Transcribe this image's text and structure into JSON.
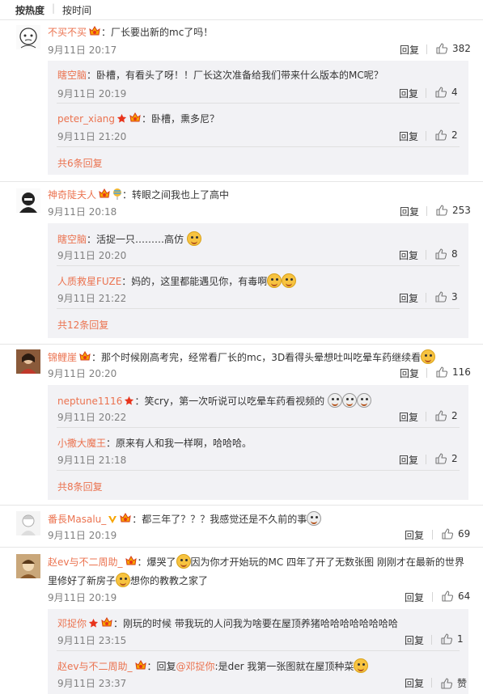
{
  "sort": {
    "hot": "按热度",
    "time": "按时间"
  },
  "actions": {
    "reply": "回复"
  },
  "c1": {
    "user": "不买不买",
    "text": "：厂长要出新的mc了吗！",
    "time": "9月11日 20:17",
    "likes": "382"
  },
  "c1r1": {
    "user": "瞎空脑",
    "text": "：卧槽，有看头了呀！！厂长这次准备给我们带来什么版本的MC呢？",
    "time": "9月11日 20:19",
    "likes": "4"
  },
  "c1r2": {
    "user": "peter_xiang",
    "text": "：卧槽，熏多尼？",
    "time": "9月11日 21:20",
    "likes": "2"
  },
  "c1more": "共6条回复",
  "c2": {
    "user": "神奇陡夫人",
    "text": "：转眼之间我也上了高中",
    "time": "9月11日 20:18",
    "likes": "253"
  },
  "c2r1": {
    "user": "瞎空脑",
    "text": "：活捉一只………高仿",
    "time": "9月11日 20:20",
    "likes": "8"
  },
  "c2r2": {
    "user": "人质救星FUZE",
    "text": "：妈的，这里都能遇见你，有毒啊",
    "time": "9月11日 21:22",
    "likes": "3"
  },
  "c2more": "共12条回复",
  "c3": {
    "user": "锦鲤崖",
    "text": "：那个时候刚高考完，经常看厂长的mc，3D看得头晕想吐叫吃晕车药继续看",
    "time": "9月11日 20:20",
    "likes": "116"
  },
  "c3r1": {
    "user": "neptune1116",
    "text": "：笑cry，第一次听说可以吃晕车药看视频的",
    "time": "9月11日 20:22",
    "likes": "2"
  },
  "c3r2": {
    "user": "小撒大魔王",
    "text": "：原来有人和我一样啊，哈哈哈。",
    "time": "9月11日 21:18",
    "likes": "2"
  },
  "c3more": "共8条回复",
  "c4": {
    "user": "番長Masalu_",
    "text": "：都三年了？？？我感觉还是不久前的事",
    "time": "9月11日 20:19",
    "likes": "69"
  },
  "c5": {
    "user": "赵ev与不二周助_",
    "text1": "：爆哭了",
    "text2": "因为你才开始玩的MC 四年了开了无数张图 刚刚才在最新的世界",
    "text3": "里修好了新房子",
    "text4": "想你的教教之家了",
    "time": "9月11日 20:19",
    "likes": "64"
  },
  "c5r1": {
    "user": "邓捉你",
    "text": "：刚玩的时候 带我玩的人问我为啥要在屋顶养猪哈哈哈哈哈哈哈哈",
    "time": "9月11日 23:15",
    "likes": "1"
  },
  "c5r2": {
    "user": "赵ev与不二周助_",
    "text_a": "：回复",
    "mention": "@邓捉你",
    "text_b": ":是der 我第一张图就在屋顶种菜",
    "time": "9月11日 23:37",
    "likes": "赞"
  },
  "colors": {
    "link": "#eb7350",
    "meta": "#808080",
    "subbg": "#f2f2f5"
  }
}
